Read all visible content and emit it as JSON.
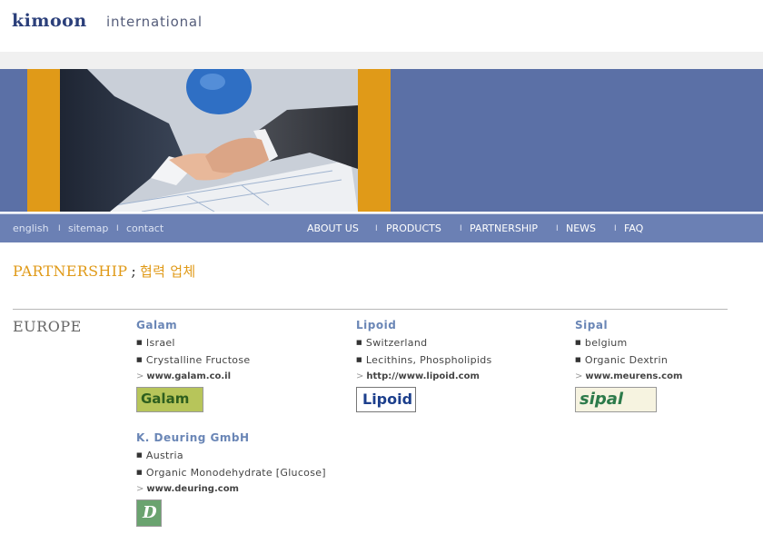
{
  "header": {
    "brand": "kimoon",
    "sub": "international"
  },
  "nav": {
    "utility": [
      "english",
      "sitemap",
      "contact"
    ],
    "main": [
      "ABOUT US",
      "PRODUCTS",
      "PARTNERSHIP",
      "NEWS",
      "FAQ"
    ],
    "separator": "I"
  },
  "page": {
    "title": "PARTNERSHIP",
    "title_sep": ";",
    "title_kr": "협력 업체",
    "region": "EUROPE"
  },
  "partners": [
    {
      "name": "Galam",
      "items": [
        "Israel",
        "Crystalline Fructose"
      ],
      "url": "www.galam.co.il",
      "logo_text": "Galam"
    },
    {
      "name": "Lipoid",
      "items": [
        "Switzerland",
        "Lecithins, Phospholipids"
      ],
      "url": "http://www.lipoid.com",
      "logo_text": "Lipoid"
    },
    {
      "name": "Sipal",
      "items": [
        "belgium",
        "Organic Dextrin"
      ],
      "url": "www.meurens.com",
      "logo_text": "sipal"
    },
    {
      "name": "K. Deuring GmbH",
      "items": [
        "Austria",
        "Organic Monodehydrate [Glucose]"
      ],
      "url": "www.deuring.com",
      "logo_text": "D"
    }
  ],
  "colors": {
    "banner_blue": "#5b70a6",
    "nav_blue": "#6b80b4",
    "accent_orange": "#e09a18",
    "partner_name": "#6a86b6"
  },
  "icons": {
    "bullet": "square-bullet-icon",
    "url_arrow": "gt-arrow-icon"
  }
}
